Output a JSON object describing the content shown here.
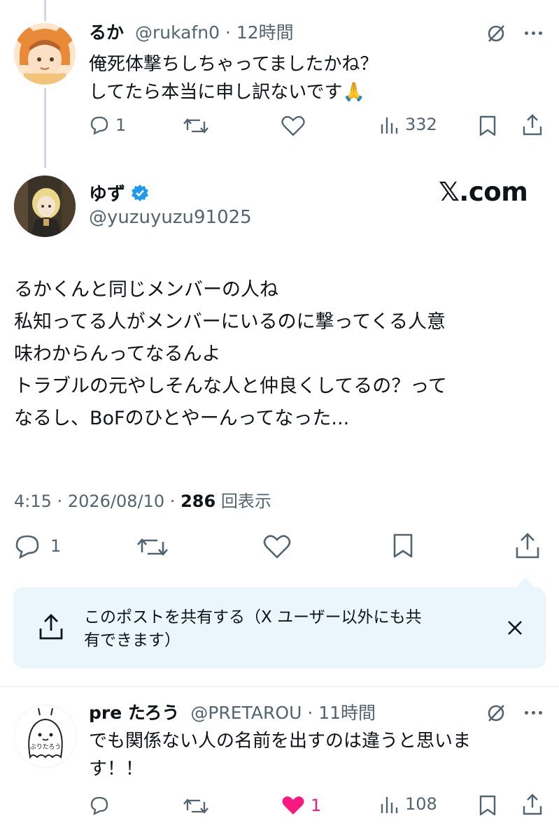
{
  "reply1": {
    "display_name": "るか",
    "handle": "@rukafn0",
    "separator": "·",
    "time": "12時間",
    "text_line1": "俺死体撃ちしちゃってましたかね？",
    "text_line2": "してたら本当に申し訳ないです🙏",
    "replies": "1",
    "views": "332"
  },
  "main": {
    "display_name": "ゆず",
    "handle": "@yuzuyuzu91025",
    "brand": "𝕏.com",
    "lines": [
      "るかくんと同じメンバーの人ね",
      "私知ってる人がメンバーにいるのに撃ってくる人意",
      "味わからんってなるんよ",
      "トラブルの元やしそんな人と仲良くしてるの？って",
      "なるし、BoFのひとやーんってなった..."
    ],
    "time": "4:15",
    "sep": "·",
    "date": "2026/08/10",
    "views": "286",
    "views_label": "回表示",
    "replies": "1"
  },
  "share_banner": {
    "line1": "このポストを共有する（X ユーザー以外にも共",
    "line2": "有できます）"
  },
  "reply2": {
    "display_name": "pre たろう",
    "handle": "@PRETAROU",
    "separator": "·",
    "time": "11時間",
    "text_line1": "でも関係ない人の名前を出すのは違うと思いま",
    "text_line2": "す！！",
    "likes": "1",
    "views": "108"
  },
  "colors": {
    "text": "#0f1419",
    "muted": "#536471",
    "verified": "#1d9bf0",
    "like": "#f91880",
    "banner_bg": "#eaf6fc"
  }
}
